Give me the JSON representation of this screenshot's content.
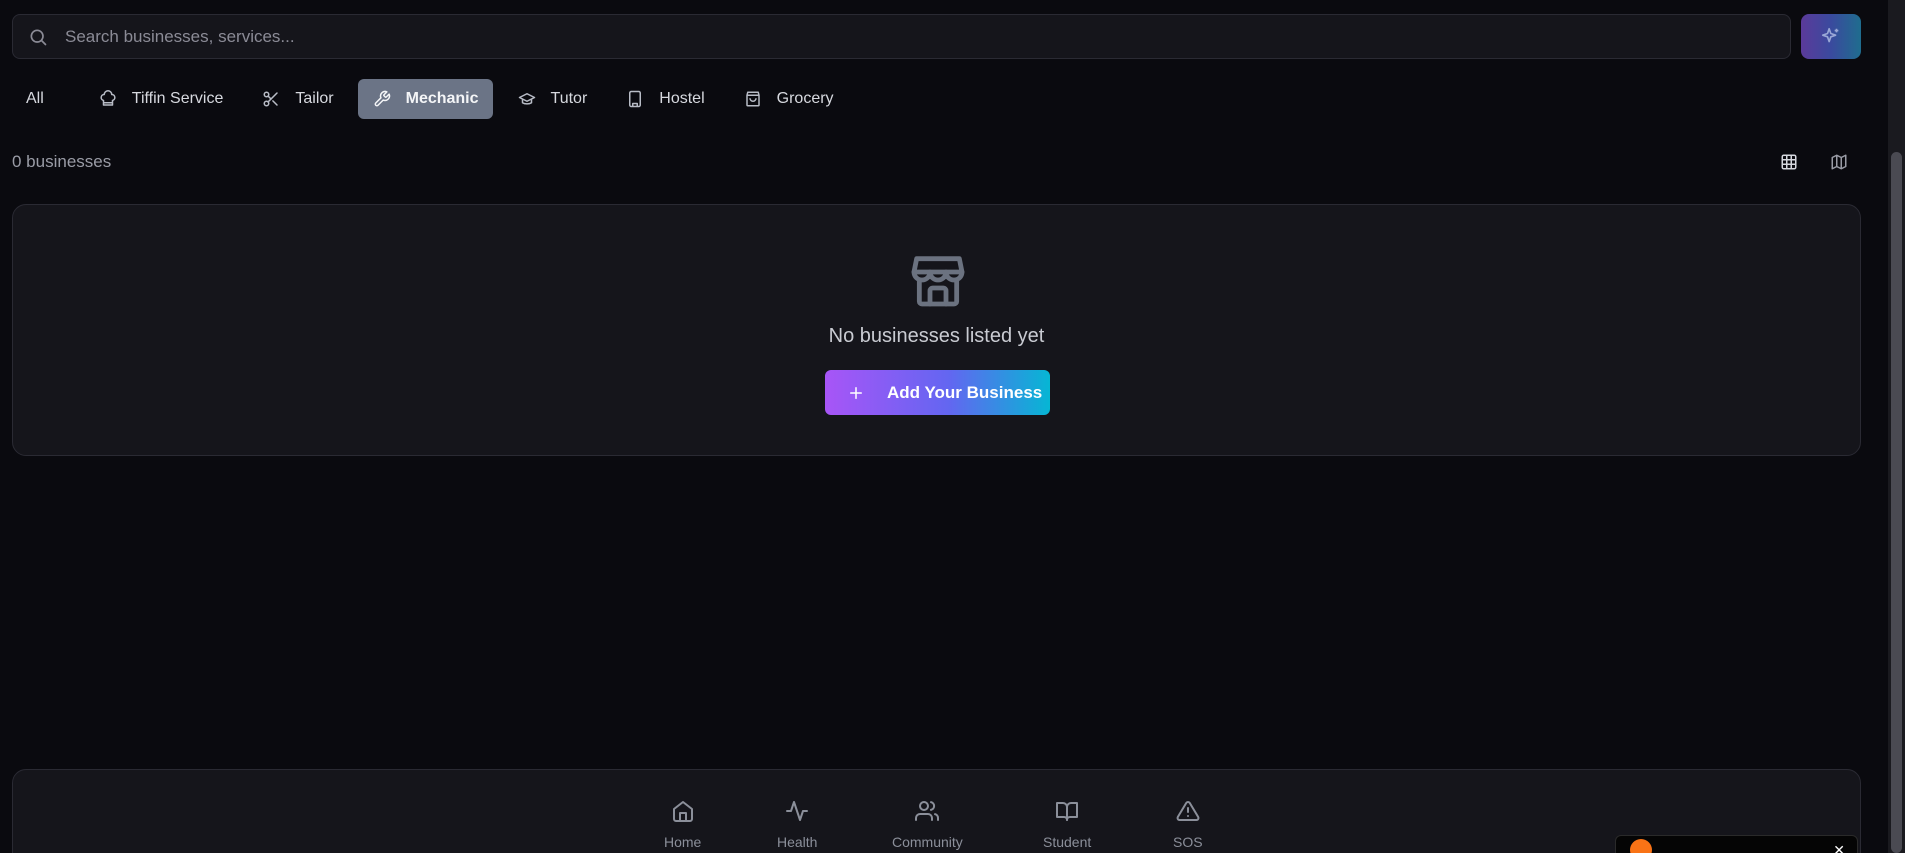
{
  "search": {
    "placeholder": "Search businesses, services...",
    "search_icon": "search-icon",
    "ai_icon": "sparkles-icon"
  },
  "categories": [
    {
      "label": "All",
      "icon": ""
    },
    {
      "label": "Tiffin Service",
      "icon": "chef-hat-icon"
    },
    {
      "label": "Tailor",
      "icon": "scissors-icon"
    },
    {
      "label": "Mechanic",
      "icon": "wrench-icon",
      "active": true
    },
    {
      "label": "Tutor",
      "icon": "graduation-cap-icon"
    },
    {
      "label": "Hostel",
      "icon": "building-icon"
    },
    {
      "label": "Grocery",
      "icon": "shopping-bag-icon"
    }
  ],
  "results": {
    "count_label": "0 businesses"
  },
  "view_toggles": {
    "grid_icon": "grid-icon",
    "map_icon": "map-icon"
  },
  "empty_state": {
    "icon": "store-icon",
    "message": "No businesses listed yet",
    "button_label": "Add Your Business"
  },
  "bottom_nav": [
    {
      "label": "Home",
      "icon": "home-icon"
    },
    {
      "label": "Health",
      "icon": "activity-icon"
    },
    {
      "label": "Community",
      "icon": "users-icon"
    },
    {
      "label": "Student",
      "icon": "book-open-icon"
    },
    {
      "label": "SOS",
      "icon": "alert-triangle-icon"
    }
  ],
  "colors": {
    "background": "#0a0a0f",
    "card": "#15151b",
    "active_tab": "#6b7486",
    "gradient_start": "#a855f7",
    "gradient_end": "#06b6d4"
  }
}
